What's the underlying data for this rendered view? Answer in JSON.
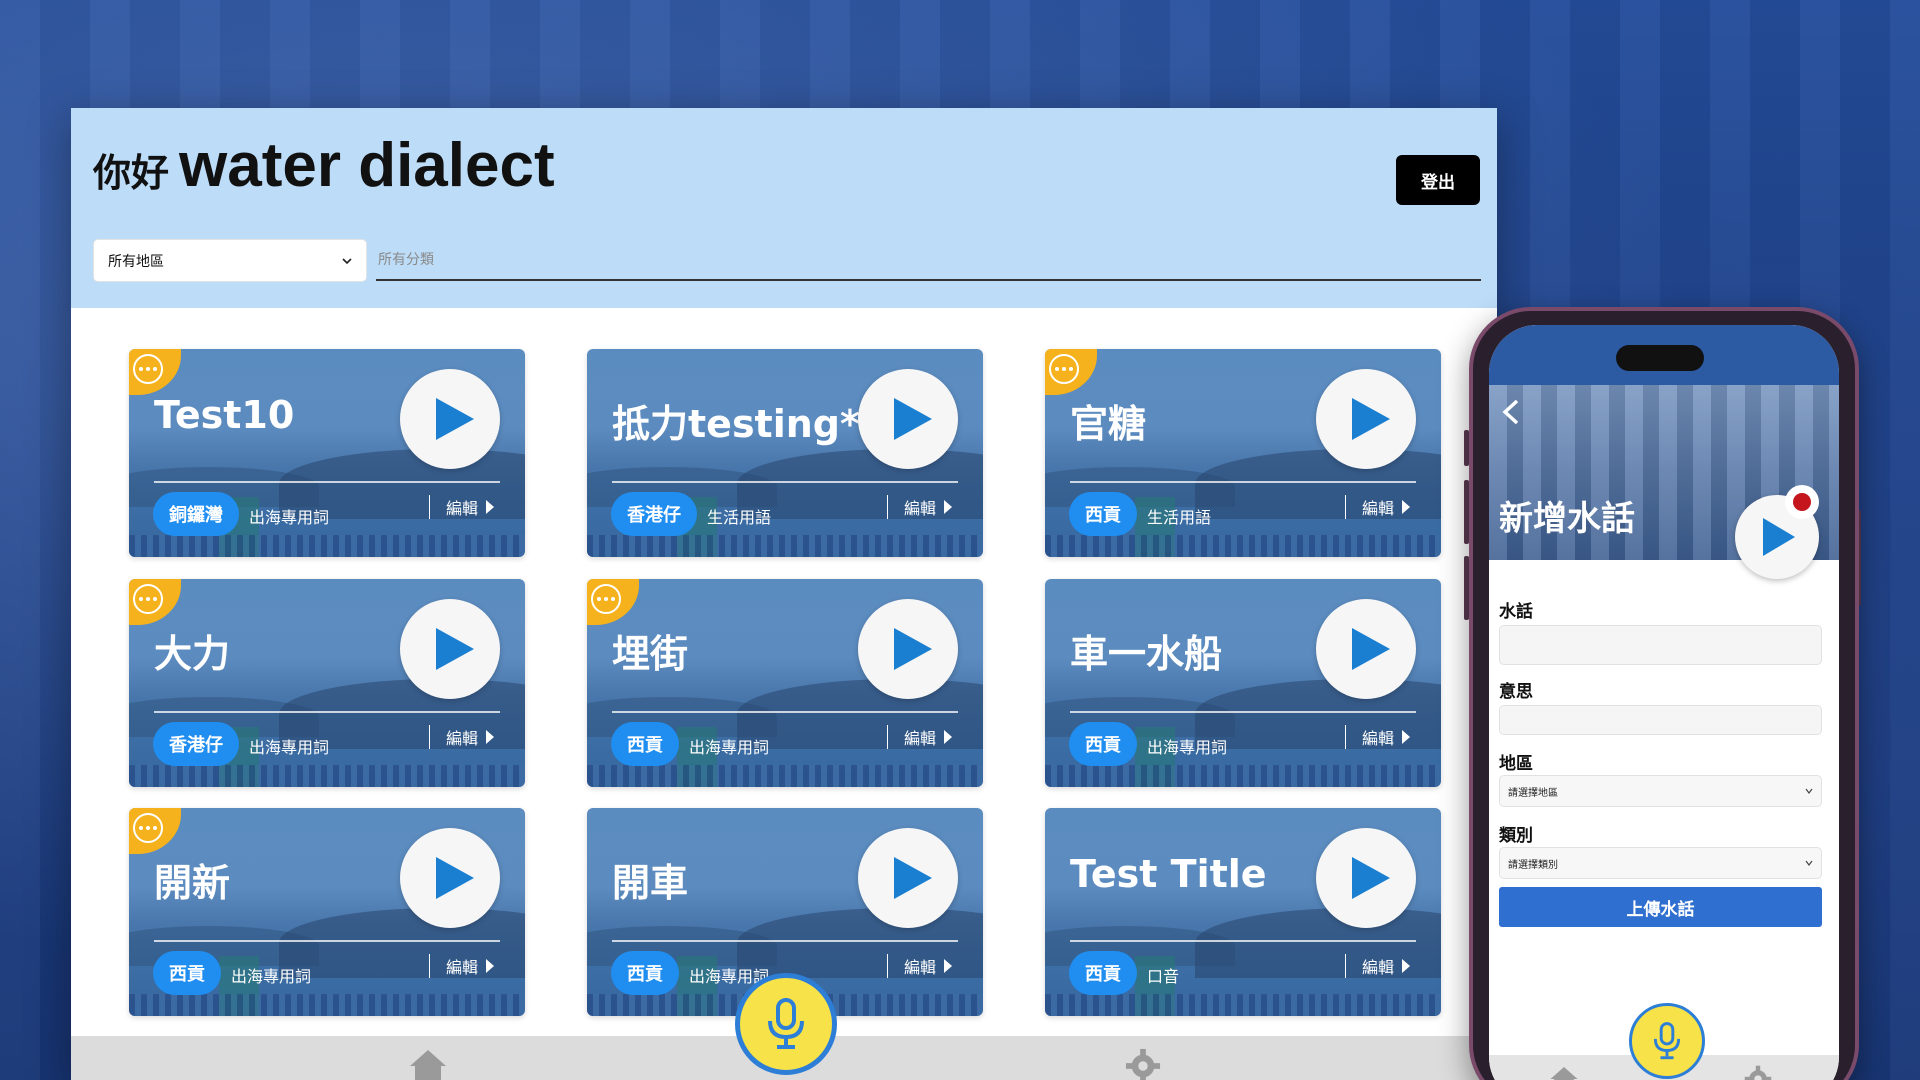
{
  "header": {
    "greeting": "你好",
    "app_name": "water dialect",
    "logout_label": "登出",
    "region_select_value": "所有地區",
    "category_placeholder": "所有分類"
  },
  "cards": [
    {
      "word": "Test10",
      "region": "銅鑼灣",
      "category": "出海專用詞",
      "edit_label": "編輯",
      "has_badge": true
    },
    {
      "word": "抵力testing*2",
      "region": "香港仔",
      "category": "生活用語",
      "edit_label": "編輯",
      "has_badge": false
    },
    {
      "word": "官糖",
      "region": "西貢",
      "category": "生活用語",
      "edit_label": "編輯",
      "has_badge": true
    },
    {
      "word": "大力",
      "region": "香港仔",
      "category": "出海專用詞",
      "edit_label": "編輯",
      "has_badge": true
    },
    {
      "word": "埋街",
      "region": "西貢",
      "category": "出海專用詞",
      "edit_label": "編輯",
      "has_badge": true
    },
    {
      "word": "車一水船",
      "region": "西貢",
      "category": "出海專用詞",
      "edit_label": "編輯",
      "has_badge": false
    },
    {
      "word": "開新",
      "region": "西貢",
      "category": "出海專用詞",
      "edit_label": "編輯",
      "has_badge": true
    },
    {
      "word": "開車",
      "region": "西貢",
      "category": "出海專用詞",
      "edit_label": "編輯",
      "has_badge": false
    },
    {
      "word": "Test Title",
      "region": "西貢",
      "category": "口音",
      "edit_label": "編輯",
      "has_badge": false
    }
  ],
  "phone": {
    "title": "新增水話",
    "field_water_label": "水話",
    "field_meaning_label": "意思",
    "field_region_label": "地區",
    "region_select_value": "請選擇地區",
    "field_category_label": "類別",
    "category_select_value": "請選擇類別",
    "upload_label": "上傳水話"
  },
  "colors": {
    "header_bg": "#bcdcf8",
    "badge": "#f5b21c",
    "region_pill": "#1f8ef0",
    "play_icon": "#1a7fd1",
    "mic_bg": "#f7e24a",
    "mic_ring": "#2d7ed7",
    "upload_button": "#2f6fcf"
  },
  "icons": [
    "more-icon",
    "play-icon",
    "chevron-right-icon",
    "microphone-icon",
    "home-icon",
    "gear-icon",
    "back-icon",
    "record-icon",
    "chevron-down-icon"
  ]
}
